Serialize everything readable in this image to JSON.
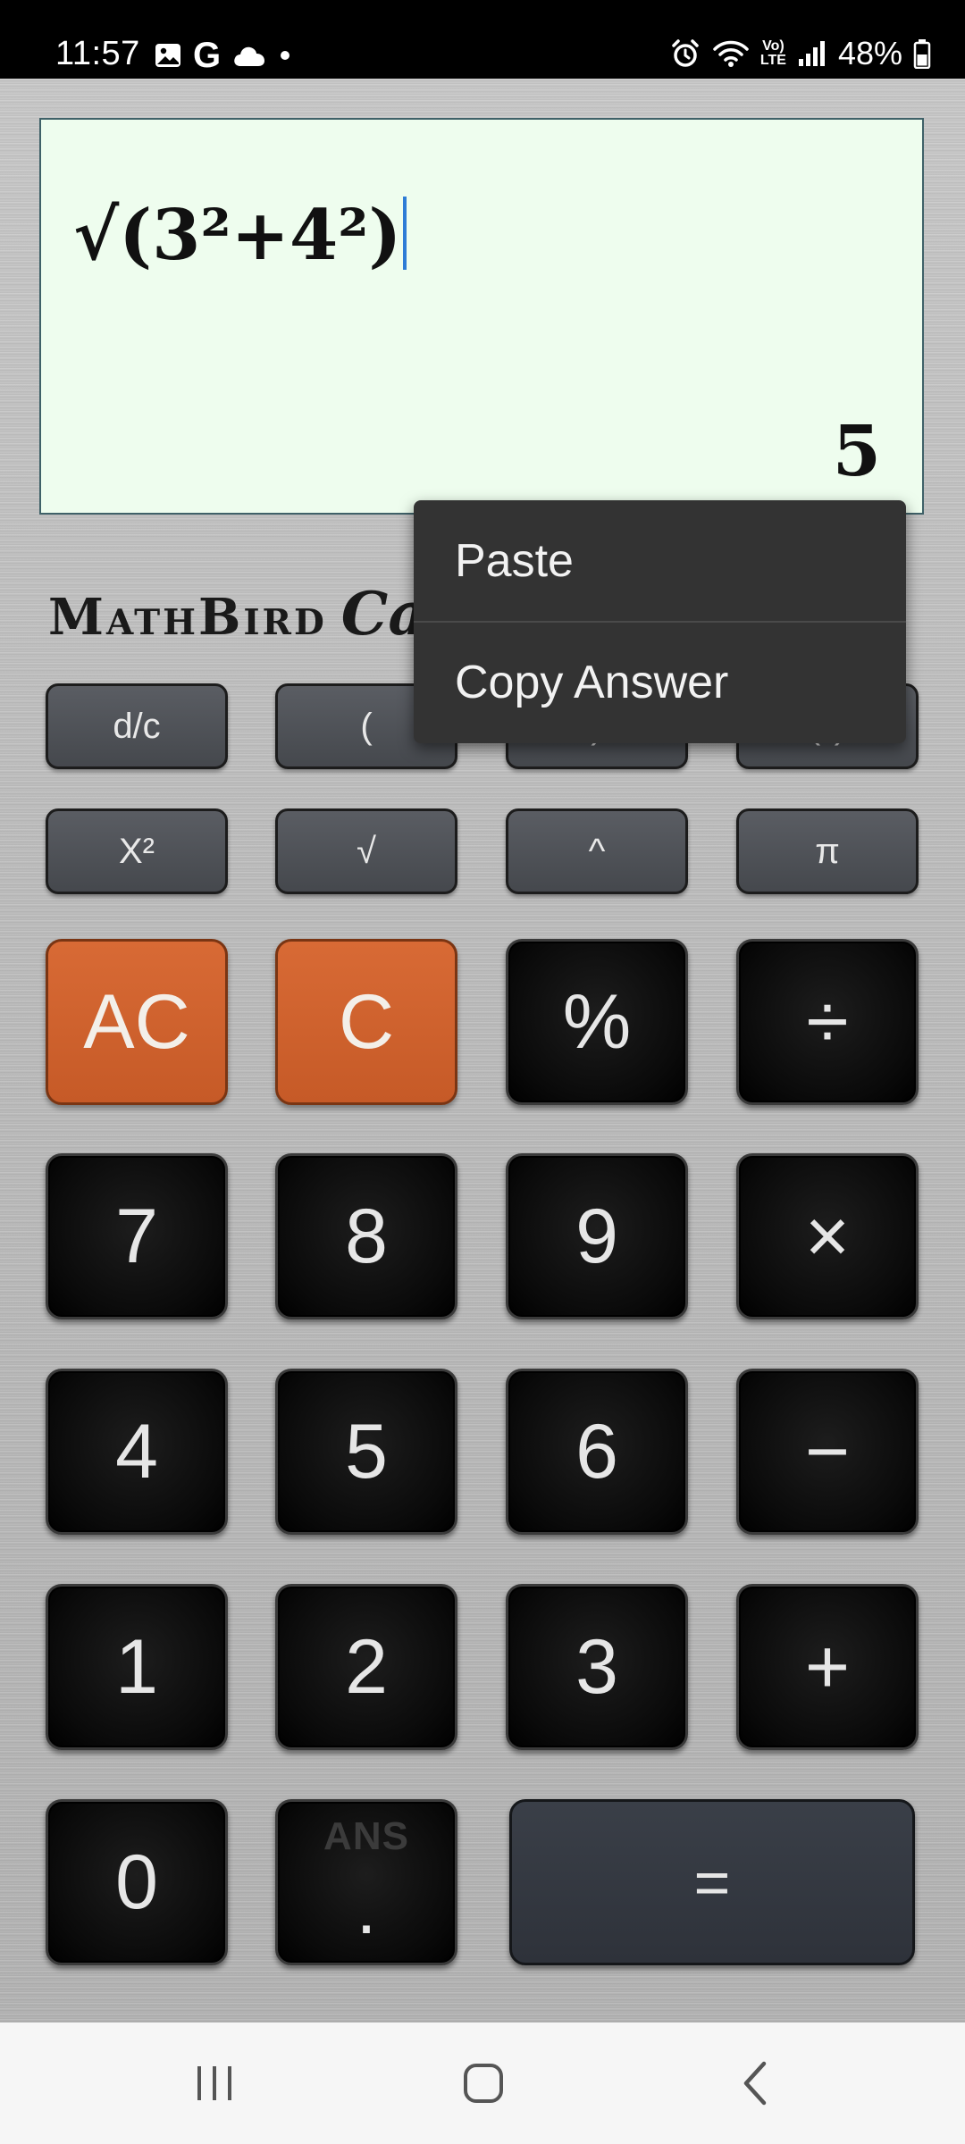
{
  "status_bar": {
    "time": "11:57",
    "battery_percent": "48%",
    "icons_left": [
      "gallery-icon",
      "google-icon",
      "cloud-icon",
      "dot-icon"
    ],
    "icons_right": [
      "alarm-icon",
      "wifi-icon",
      "volte-icon",
      "signal-icon",
      "battery-icon"
    ],
    "volte_label_top": "Vo)",
    "volte_label_bottom": "LTE",
    "google_letter": "G"
  },
  "display": {
    "expression": "√(3²+4²)",
    "result": "5"
  },
  "brand": {
    "main": "MathBird",
    "script": "Calc"
  },
  "context_menu": {
    "items": [
      {
        "label": "Paste"
      },
      {
        "label": "Copy Answer"
      }
    ]
  },
  "keys": {
    "row1": [
      "d/c",
      "(",
      ")",
      "(*)"
    ],
    "row2": [
      "X²",
      "√",
      "^",
      "π"
    ],
    "row3": [
      "AC",
      "C",
      "%",
      "÷"
    ],
    "row4": [
      "7",
      "8",
      "9",
      "×"
    ],
    "row5": [
      "4",
      "5",
      "6",
      "−"
    ],
    "row6": [
      "1",
      "2",
      "3",
      "+"
    ],
    "row7": {
      "zero": "0",
      "ans": "ANS",
      "dot": ".",
      "equals": "="
    }
  },
  "colors": {
    "display_bg": "#eefdee",
    "orange_key": "#d0622e",
    "dark_key": "#0a0a0a",
    "fn_key": "#4f5257",
    "popup_bg": "#333333",
    "cursor": "#2e7cd6"
  },
  "nav_bar": {
    "buttons": [
      "recent-apps-icon",
      "home-icon",
      "back-icon"
    ]
  }
}
